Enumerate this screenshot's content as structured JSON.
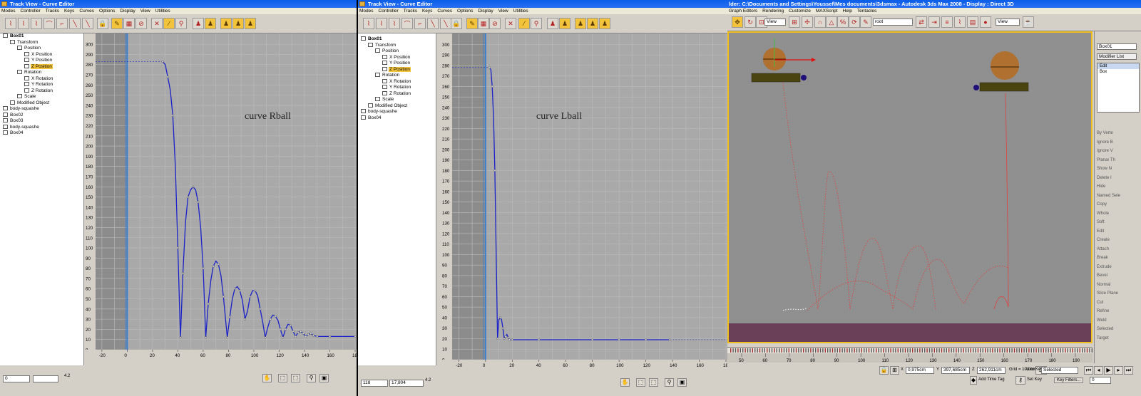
{
  "left": {
    "title": "Track View - Curve Editor",
    "menus": [
      "Modes",
      "Controller",
      "Tracks",
      "Keys",
      "Curves",
      "Options",
      "Display",
      "View",
      "Utilities"
    ],
    "tree": [
      {
        "label": "Box01",
        "depth": 0,
        "bold": true
      },
      {
        "label": "Transform",
        "depth": 1
      },
      {
        "label": "Position",
        "depth": 2
      },
      {
        "label": "X Position",
        "depth": 3
      },
      {
        "label": "Y Position",
        "depth": 3
      },
      {
        "label": "Z Position",
        "depth": 3,
        "selected": true
      },
      {
        "label": "Rotation",
        "depth": 2
      },
      {
        "label": "X Rotation",
        "depth": 3
      },
      {
        "label": "Y Rotation",
        "depth": 3
      },
      {
        "label": "Z Rotation",
        "depth": 3
      },
      {
        "label": "Scale",
        "depth": 2
      },
      {
        "label": "Modified Object",
        "depth": 1
      },
      {
        "label": "body-squashe",
        "depth": 0
      },
      {
        "label": "Box02",
        "depth": 0
      },
      {
        "label": "Box03",
        "depth": 0
      },
      {
        "label": "body-squashe",
        "depth": 0
      },
      {
        "label": "Box04",
        "depth": 0
      }
    ],
    "annotation": "curve Rball",
    "y_ticks": [
      "300",
      "290",
      "280",
      "270",
      "260",
      "250",
      "240",
      "230",
      "220",
      "210",
      "200",
      "190",
      "180",
      "170",
      "160",
      "150",
      "140",
      "130",
      "120",
      "110",
      "100",
      "90",
      "80",
      "70",
      "60",
      "50",
      "40",
      "30",
      "20",
      "10",
      "0"
    ],
    "x_ticks": [
      "-20",
      "0",
      "20",
      "40",
      "60",
      "80",
      "100",
      "120",
      "140",
      "160",
      "180"
    ],
    "status_field1": "0",
    "status_field2": "",
    "zoom_label": "4.2",
    "curve_points": [
      [
        28,
        283
      ],
      [
        30,
        280
      ],
      [
        32,
        268
      ],
      [
        34,
        255
      ],
      [
        36,
        230
      ],
      [
        38,
        180
      ],
      [
        40,
        100
      ],
      [
        42,
        12
      ],
      [
        44,
        75
      ],
      [
        46,
        125
      ],
      [
        48,
        150
      ],
      [
        50,
        157
      ],
      [
        52,
        160
      ],
      [
        54,
        157
      ],
      [
        56,
        145
      ],
      [
        58,
        120
      ],
      [
        60,
        80
      ],
      [
        62,
        12
      ],
      [
        64,
        45
      ],
      [
        66,
        68
      ],
      [
        68,
        82
      ],
      [
        70,
        87
      ],
      [
        72,
        84
      ],
      [
        74,
        73
      ],
      [
        76,
        52
      ],
      [
        79,
        12
      ],
      [
        81,
        32
      ],
      [
        83,
        50
      ],
      [
        85,
        60
      ],
      [
        87,
        62
      ],
      [
        89,
        58
      ],
      [
        91,
        48
      ],
      [
        93,
        30
      ],
      [
        95,
        38
      ],
      [
        97,
        52
      ],
      [
        99,
        58
      ],
      [
        101,
        58
      ],
      [
        103,
        53
      ],
      [
        105,
        40
      ],
      [
        107,
        27
      ],
      [
        109,
        12
      ],
      [
        111,
        22
      ],
      [
        113,
        30
      ],
      [
        115,
        34
      ],
      [
        117,
        33
      ],
      [
        119,
        29
      ],
      [
        121,
        20
      ],
      [
        123,
        12
      ],
      [
        125,
        20
      ],
      [
        127,
        25
      ],
      [
        129,
        24
      ],
      [
        131,
        18
      ],
      [
        133,
        13
      ],
      [
        135,
        17
      ],
      [
        137,
        18
      ],
      [
        139,
        16
      ],
      [
        141,
        13
      ],
      [
        143,
        15
      ],
      [
        145,
        16
      ],
      [
        147,
        14
      ],
      [
        150,
        13
      ],
      [
        160,
        13
      ],
      [
        180,
        13
      ]
    ]
  },
  "middle": {
    "title": "Track View - Curve Editor",
    "menus": [
      "Modes",
      "Controller",
      "Tracks",
      "Keys",
      "Curves",
      "Options",
      "Display",
      "View",
      "Utilities"
    ],
    "tree": [
      {
        "label": "Box01",
        "depth": 0,
        "bold": true
      },
      {
        "label": "Transform",
        "depth": 1
      },
      {
        "label": "Position",
        "depth": 2
      },
      {
        "label": "X Position",
        "depth": 3
      },
      {
        "label": "Y Position",
        "depth": 3
      },
      {
        "label": "Z Position",
        "depth": 3,
        "selected": true
      },
      {
        "label": "Rotation",
        "depth": 2
      },
      {
        "label": "X Rotation",
        "depth": 3
      },
      {
        "label": "Y Rotation",
        "depth": 3
      },
      {
        "label": "Z Rotation",
        "depth": 3
      },
      {
        "label": "Scale",
        "depth": 2
      },
      {
        "label": "Modified Object",
        "depth": 1
      },
      {
        "label": "body-squashe",
        "depth": 0
      },
      {
        "label": "Box04",
        "depth": 0
      }
    ],
    "annotation": "curve Lball",
    "y_ticks": [
      "300",
      "290",
      "280",
      "270",
      "260",
      "250",
      "240",
      "230",
      "220",
      "210",
      "200",
      "190",
      "180",
      "170",
      "160",
      "150",
      "140",
      "130",
      "120",
      "110",
      "100",
      "90",
      "80",
      "70",
      "60",
      "50",
      "40",
      "30",
      "20",
      "10",
      "0"
    ],
    "x_ticks": [
      "-20",
      "0",
      "20",
      "40",
      "60",
      "80",
      "100",
      "120",
      "140",
      "160",
      "180"
    ],
    "status_field1": "118",
    "status_field2": "17,804",
    "zoom_label": "4.2",
    "curve_points": [
      [
        3,
        278
      ],
      [
        4,
        276
      ],
      [
        5,
        260
      ],
      [
        6,
        230
      ],
      [
        7,
        180
      ],
      [
        8,
        100
      ],
      [
        9,
        20
      ],
      [
        10,
        38
      ],
      [
        11,
        40
      ],
      [
        12,
        38
      ],
      [
        13,
        30
      ],
      [
        14,
        20
      ],
      [
        15,
        22
      ],
      [
        16,
        24
      ],
      [
        17,
        21
      ],
      [
        18,
        19
      ],
      [
        20,
        19
      ],
      [
        40,
        19
      ],
      [
        80,
        19
      ],
      [
        100,
        19
      ],
      [
        120,
        19
      ],
      [
        138,
        19
      ]
    ]
  },
  "right": {
    "title": "lder: C:\\Documents and Settings\\Youssef\\Mes documents\\3dsmax     - Autodesk 3ds Max 2008     - Display : Direct 3D",
    "menus": [
      "Graph Editors",
      "Rendering",
      "Customize",
      "MAXScript",
      "Help",
      "Tentacles"
    ],
    "view_dropdown": "View",
    "root_dropdown": "root",
    "view_dropdown2": "View",
    "timeline_ticks": [
      "50",
      "60",
      "70",
      "80",
      "90",
      "100",
      "110",
      "120",
      "130",
      "140",
      "150",
      "160",
      "170",
      "180",
      "190"
    ],
    "coord_x": "0,975cm",
    "coord_y": "397,685cm",
    "coord_z": "262,911cm",
    "grid": "Grid = 10,0cm",
    "auto_key": "Auto Key",
    "selected": "Selected",
    "set_key": "Set Key",
    "key_filters": "Key Filters...",
    "add_time_tag": "Add Time Tag",
    "frame_field": "0",
    "cmd_panel": {
      "name_field": "Box01",
      "modifier_list": "Modifier List",
      "stack": [
        "Edit",
        "Box"
      ],
      "labels": [
        "By Verte",
        "Ignore B",
        "Ignore V",
        "Planar Th",
        "Show N",
        "Delete I",
        "Hide",
        "Named Sele",
        "Copy",
        "Whole",
        "Soft",
        "Edit",
        "Create",
        "Attach",
        "Break",
        "Extrude",
        "Bevel",
        "Normal",
        "Slice Plane",
        "Cut",
        "Refine",
        "Weld",
        "Selected",
        "Target"
      ]
    },
    "colors": {
      "viewport": "#8f8f8f",
      "curve": "#e04040",
      "floor": "#6a4058",
      "border": "#f0c020"
    }
  }
}
